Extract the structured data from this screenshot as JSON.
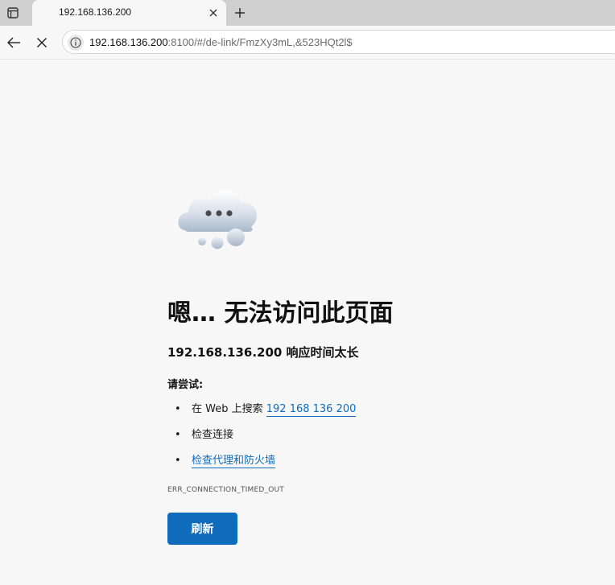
{
  "browser": {
    "tab": {
      "title": "192.168.136.200"
    },
    "address_bar": {
      "host": "192.168.136.200",
      "path": ":8100/#/de-link/FmzXy3mL,&523HQt2l$"
    },
    "icons": {
      "tab_strip": "tab-actions-icon",
      "tab_close": "close-icon",
      "new_tab": "plus-icon",
      "back": "arrow-left-icon",
      "stop": "close-icon",
      "site_info": "info-icon"
    }
  },
  "error_page": {
    "illustration": "cloud-icon",
    "heading": "嗯… 无法访问此页面",
    "subheading": "192.168.136.200 响应时间太长",
    "try_label": "请尝试:",
    "suggestions": [
      {
        "prefix": "在 Web 上搜索 ",
        "link": "192 168 136 200"
      },
      {
        "prefix": "检查连接",
        "link": ""
      },
      {
        "prefix": "",
        "link": "检查代理和防火墙"
      }
    ],
    "error_code": "ERR_CONNECTION_TIMED_OUT",
    "refresh_label": "刷新"
  },
  "colors": {
    "accent": "#0f6cbd",
    "background": "#f7f7f7",
    "tabbar": "#cfcfcf"
  }
}
